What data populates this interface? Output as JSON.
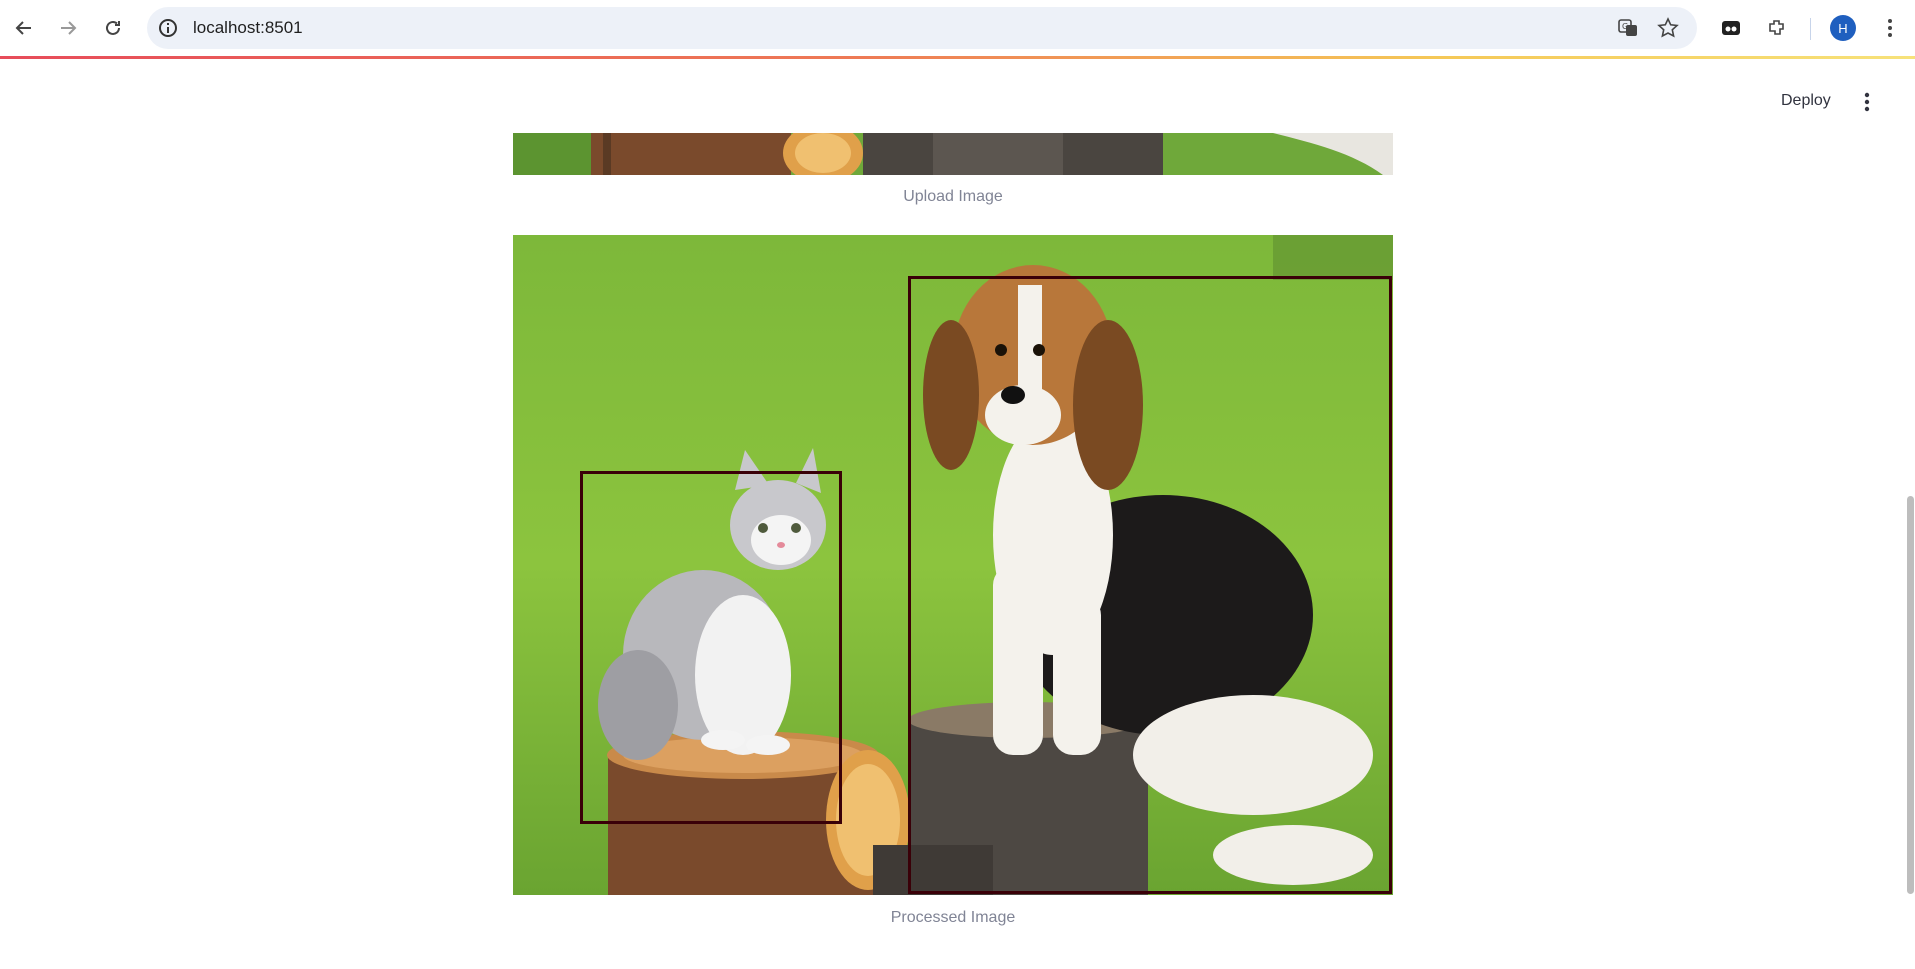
{
  "browser": {
    "url": "localhost:8501",
    "profile_initial": "H",
    "icons": [
      "back-icon",
      "forward-icon",
      "reload-icon",
      "site-info-icon",
      "translate-icon",
      "star-icon",
      "tab-search-icon",
      "extensions-icon",
      "menu-icon"
    ]
  },
  "header": {
    "deploy_label": "Deploy"
  },
  "images": [
    {
      "caption": "Upload Image"
    },
    {
      "caption": "Processed Image",
      "detections": [
        "cat",
        "dog"
      ]
    }
  ],
  "colors": {
    "bbox": "#3a0008",
    "grass": "#7cb33b",
    "caption": "#808495"
  }
}
